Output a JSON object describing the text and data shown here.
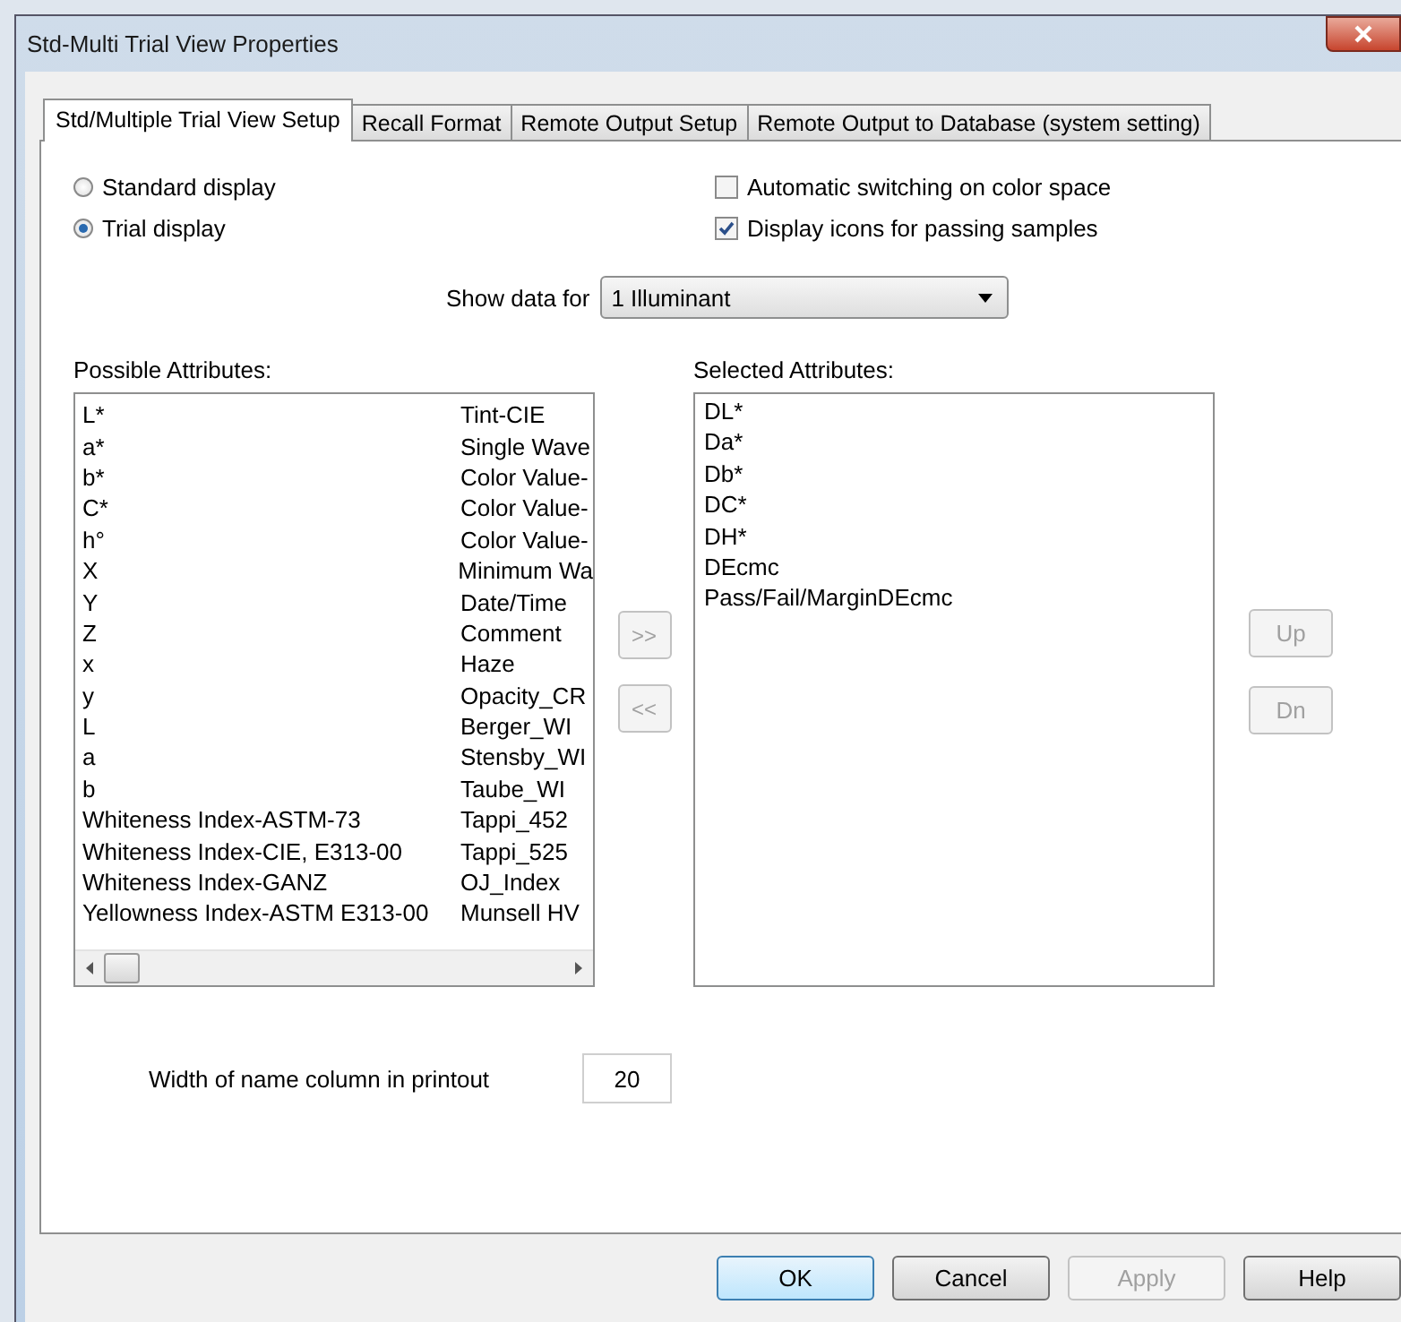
{
  "window": {
    "title": "Std-Multi Trial View Properties"
  },
  "tabs": [
    {
      "label": "Std/Multiple Trial View Setup",
      "selected": true
    },
    {
      "label": "Recall Format",
      "selected": false
    },
    {
      "label": "Remote Output Setup",
      "selected": false
    },
    {
      "label": "Remote Output to Database (system setting)",
      "selected": false
    }
  ],
  "display_mode": [
    {
      "label": "Standard display",
      "selected": false
    },
    {
      "label": "Trial display",
      "selected": true
    }
  ],
  "options": [
    {
      "label": "Automatic switching on color space",
      "checked": false
    },
    {
      "label": "Display icons for passing samples",
      "checked": true
    }
  ],
  "show_data_for": {
    "label": "Show data for",
    "value": "1 Illuminant"
  },
  "possible_attributes": {
    "label": "Possible Attributes:",
    "rows": [
      {
        "column_1": "L*",
        "column_2": "Tint-CIE"
      },
      {
        "column_1": "a*",
        "column_2": "Single Wave"
      },
      {
        "column_1": "b*",
        "column_2": "Color Value-"
      },
      {
        "column_1": "C*",
        "column_2": "Color Value-"
      },
      {
        "column_1": "h°",
        "column_2": "Color Value-"
      },
      {
        "column_1": "X",
        "column_2": "Minimum Wa"
      },
      {
        "column_1": "Y",
        "column_2": "Date/Time"
      },
      {
        "column_1": "Z",
        "column_2": "Comment"
      },
      {
        "column_1": "x",
        "column_2": "Haze"
      },
      {
        "column_1": "y",
        "column_2": "Opacity_CR"
      },
      {
        "column_1": "L",
        "column_2": "Berger_WI"
      },
      {
        "column_1": "a",
        "column_2": "Stensby_WI"
      },
      {
        "column_1": "b",
        "column_2": "Taube_WI"
      },
      {
        "column_1": "Whiteness Index-ASTM-73",
        "column_2": "Tappi_452"
      },
      {
        "column_1": "Whiteness Index-CIE, E313-00",
        "column_2": "Tappi_525"
      },
      {
        "column_1": "Whiteness Index-GANZ",
        "column_2": "OJ_Index"
      },
      {
        "column_1": "Yellowness Index-ASTM E313-00",
        "column_2": "Munsell HV"
      }
    ]
  },
  "move_buttons": [
    {
      "label": ">>",
      "disabled": true
    },
    {
      "label": "<<",
      "disabled": true
    }
  ],
  "selected_attributes": {
    "label": "Selected Attributes:",
    "items": [
      "DL*",
      "Da*",
      "Db*",
      "DC*",
      "DH*",
      "DEcmc",
      "Pass/Fail/MarginDEcmc"
    ]
  },
  "order_buttons": [
    {
      "label": "Up",
      "disabled": true
    },
    {
      "label": "Dn",
      "disabled": true
    }
  ],
  "name_column_width": {
    "label": "Width of name column in printout",
    "value": "20"
  },
  "buttons": [
    {
      "label": "OK",
      "disabled": false,
      "default": true
    },
    {
      "label": "Cancel",
      "disabled": false,
      "default": false
    },
    {
      "label": "Apply",
      "disabled": true,
      "default": false
    },
    {
      "label": "Help",
      "disabled": false,
      "default": false
    }
  ]
}
